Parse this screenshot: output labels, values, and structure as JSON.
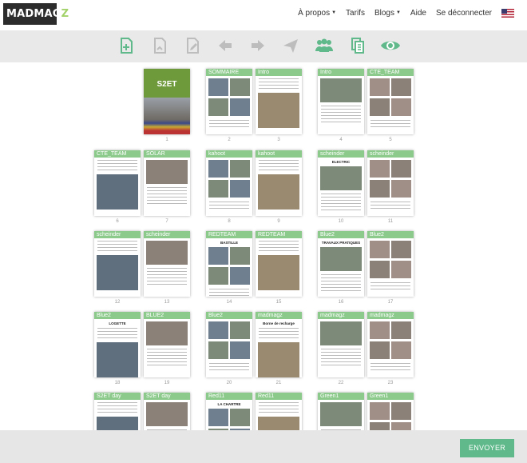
{
  "brand": {
    "logo_text": "MADMAG",
    "logo_accent": "Z"
  },
  "nav": {
    "apropos": "À propos",
    "tarifs": "Tarifs",
    "blogs": "Blogs",
    "aide": "Aide",
    "logout": "Se déconnecter",
    "lang_icon": "us-flag-icon"
  },
  "toolbar": {
    "icons": [
      "add-page-icon",
      "duplicate-page-icon",
      "edit-page-icon",
      "arrow-left-icon",
      "arrow-right-icon",
      "send-icon",
      "users-icon",
      "copy-pages-icon",
      "preview-eye-icon"
    ],
    "active_color": "#5fb98a",
    "inactive_color": "#bdbdbd"
  },
  "pages": [
    {
      "num": "1",
      "label": "",
      "kind": "cover",
      "cover_title": "S2ET"
    },
    {
      "num": "2",
      "label": "",
      "kind": "sommaire",
      "band_text": "SOMMAIRE"
    },
    {
      "num": "3",
      "label": "Intro"
    },
    {
      "num": "4",
      "label": "Intro"
    },
    {
      "num": "5",
      "label": "CTE_TEAM"
    },
    {
      "num": "6",
      "label": "CTE_TEAM"
    },
    {
      "num": "7",
      "label": "SOLAR"
    },
    {
      "num": "8",
      "label": "kahoot"
    },
    {
      "num": "9",
      "label": "kahoot"
    },
    {
      "num": "10",
      "label": "scheinder",
      "heading": "ELECTRIC"
    },
    {
      "num": "11",
      "label": "scheinder"
    },
    {
      "num": "12",
      "label": "scheinder"
    },
    {
      "num": "13",
      "label": "scheinder"
    },
    {
      "num": "14",
      "label": "REDTEAM",
      "heading": "BASTILLE"
    },
    {
      "num": "15",
      "label": "REDTEAM"
    },
    {
      "num": "16",
      "label": "Blue2",
      "heading": "TRAVAUX PRATIQUES"
    },
    {
      "num": "17",
      "label": "Blue2"
    },
    {
      "num": "18",
      "label": "Blue2",
      "heading": "LOGETTE"
    },
    {
      "num": "19",
      "label": "BLUE2"
    },
    {
      "num": "20",
      "label": "Blue2"
    },
    {
      "num": "21",
      "label": "madmagz",
      "heading": "Borne de recharge"
    },
    {
      "num": "22",
      "label": "madmagz"
    },
    {
      "num": "23",
      "label": "madmagz"
    },
    {
      "num": "",
      "label": "S2ET day"
    },
    {
      "num": "",
      "label": "S2ET day"
    },
    {
      "num": "",
      "label": "Red11",
      "heading": "LA CHARTRE"
    },
    {
      "num": "",
      "label": "Red11"
    },
    {
      "num": "",
      "label": "Green1"
    },
    {
      "num": "",
      "label": "Green1"
    }
  ],
  "footer": {
    "send_label": "ENVOYER"
  }
}
